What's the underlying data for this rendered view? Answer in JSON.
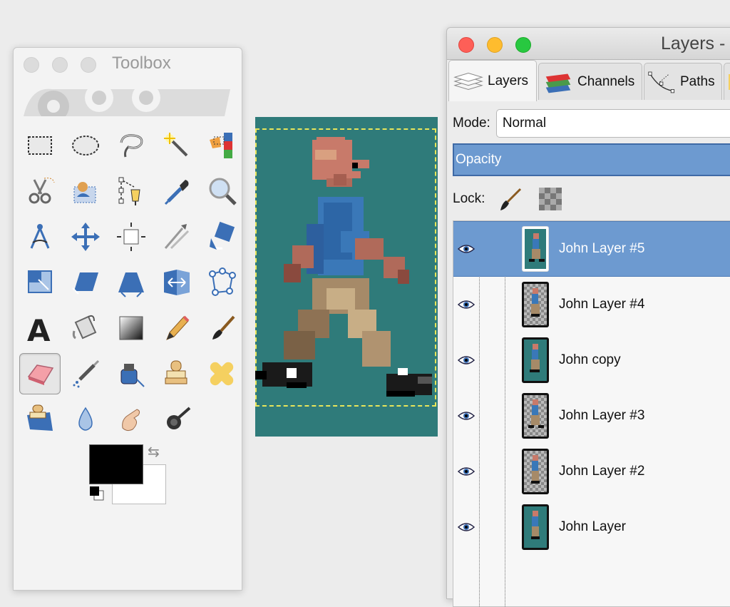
{
  "toolbox": {
    "title": "Toolbox",
    "tools": [
      {
        "name": "rect-select-icon"
      },
      {
        "name": "ellipse-select-icon"
      },
      {
        "name": "free-select-icon"
      },
      {
        "name": "fuzzy-select-icon"
      },
      {
        "name": "select-by-color-icon"
      },
      {
        "name": "scissors-select-icon"
      },
      {
        "name": "foreground-select-icon"
      },
      {
        "name": "paths-icon"
      },
      {
        "name": "color-picker-icon"
      },
      {
        "name": "zoom-icon"
      },
      {
        "name": "measure-icon"
      },
      {
        "name": "move-icon"
      },
      {
        "name": "alignment-icon"
      },
      {
        "name": "crop-icon"
      },
      {
        "name": "rotate-icon"
      },
      {
        "name": "scale-icon"
      },
      {
        "name": "shear-icon"
      },
      {
        "name": "perspective-icon"
      },
      {
        "name": "flip-icon"
      },
      {
        "name": "cage-transform-icon"
      },
      {
        "name": "text-icon"
      },
      {
        "name": "bucket-fill-icon"
      },
      {
        "name": "blend-icon"
      },
      {
        "name": "pencil-icon"
      },
      {
        "name": "paintbrush-icon"
      },
      {
        "name": "eraser-icon",
        "active": true
      },
      {
        "name": "airbrush-icon"
      },
      {
        "name": "ink-icon"
      },
      {
        "name": "clone-icon"
      },
      {
        "name": "heal-icon"
      },
      {
        "name": "perspective-clone-icon"
      },
      {
        "name": "blur-icon"
      },
      {
        "name": "smudge-icon"
      },
      {
        "name": "dodge-burn-icon"
      }
    ],
    "foreground_color": "#000000",
    "background_color": "#ffffff"
  },
  "canvas": {
    "background": "#2f7b7a"
  },
  "layers_window": {
    "title": "Layers -",
    "tabs": [
      {
        "label": "Layers",
        "icon": "layers-tab-icon"
      },
      {
        "label": "Channels",
        "icon": "channels-tab-icon"
      },
      {
        "label": "Paths",
        "icon": "paths-tab-icon"
      }
    ],
    "mode_label": "Mode:",
    "mode_value": "Normal",
    "opacity_label": "Opacity",
    "lock_label": "Lock:",
    "layers": [
      {
        "name": "John Layer #5",
        "selected": true,
        "transparent": false
      },
      {
        "name": "John Layer #4",
        "selected": false,
        "transparent": true
      },
      {
        "name": "John copy",
        "selected": false,
        "transparent": false
      },
      {
        "name": "John Layer #3",
        "selected": false,
        "transparent": true
      },
      {
        "name": "John Layer #2",
        "selected": false,
        "transparent": true
      },
      {
        "name": "John Layer",
        "selected": false,
        "transparent": false
      }
    ]
  }
}
